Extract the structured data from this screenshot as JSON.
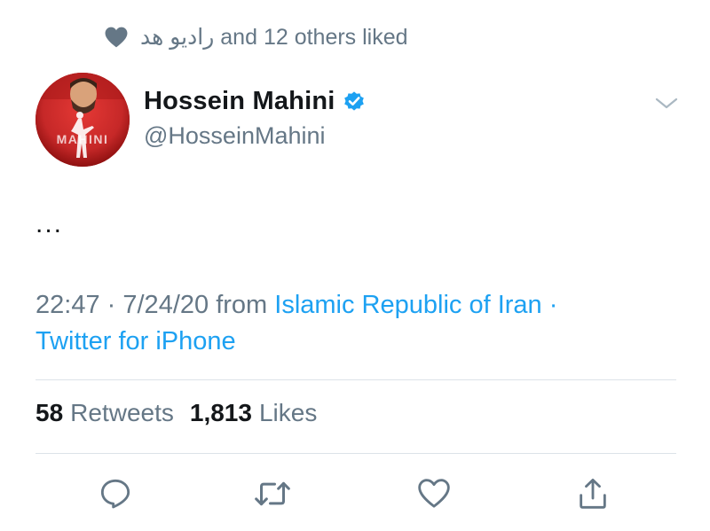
{
  "social_context": {
    "icon": "heart-icon",
    "liker_name": "رادیو هد",
    "suffix": "and 12 others liked"
  },
  "author": {
    "display_name": "Hossein Mahini",
    "handle": "@HosseinMahini",
    "verified": true,
    "avatar_text": "MAHINI"
  },
  "tweet": {
    "text": "..."
  },
  "meta": {
    "time": "22:47",
    "sep1": "·",
    "date": "7/24/20",
    "from_label": "from",
    "location": "Islamic Republic of Iran",
    "sep2": "·",
    "source": "Twitter for iPhone"
  },
  "stats": {
    "retweets_count": "58",
    "retweets_label": "Retweets",
    "likes_count": "1,813",
    "likes_label": "Likes"
  },
  "actions": [
    "reply-icon",
    "retweet-icon",
    "like-icon",
    "share-icon"
  ],
  "colors": {
    "accent": "#1da1f2",
    "secondary_text": "#657786",
    "primary_text": "#14171a",
    "divider": "#dce3e8"
  }
}
